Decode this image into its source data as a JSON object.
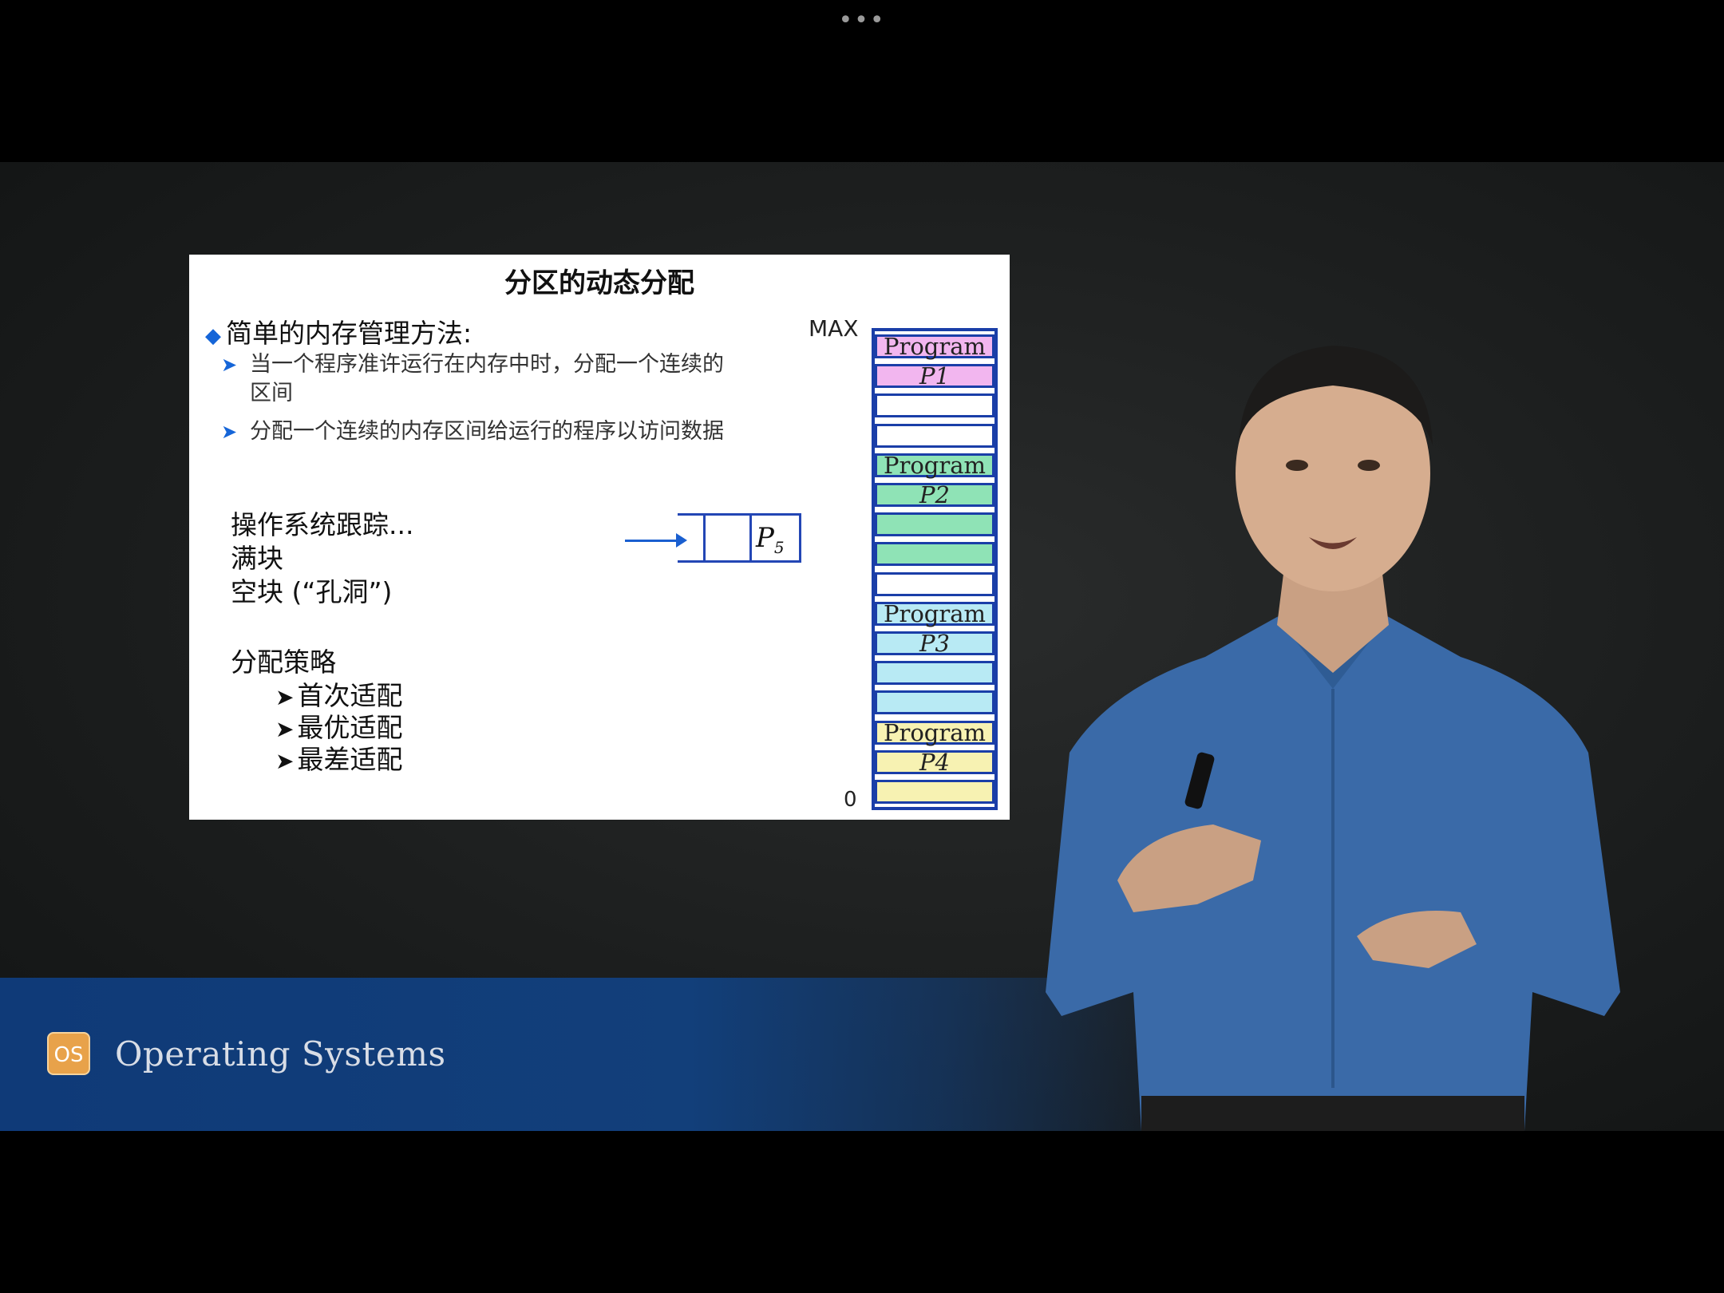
{
  "player": {
    "menu_label": "•••"
  },
  "slide": {
    "title": "分区的动态分配",
    "heading": "简单的内存管理方法:",
    "sub_items": [
      "当一个程序准许运行在内存中时，分配一个连续的区间",
      "分配一个连续的内存区间给运行的程序以访问数据"
    ],
    "tracking": "操作系统跟踪...",
    "full_block": "满块",
    "free_block": "空块 (“孔洞”)",
    "strategy_heading": "分配策略",
    "strategies": [
      "首次适配",
      "最优适配",
      "最差适配"
    ],
    "queue_label": "P",
    "queue_subscript": "5",
    "memory": {
      "max_label": "MAX",
      "zero_label": "0",
      "cells": [
        {
          "text": "Program",
          "color": "#f2b6ef"
        },
        {
          "text": "P1",
          "color": "#f2b6ef"
        },
        {
          "text": "",
          "color": "#ffffff"
        },
        {
          "text": "",
          "color": "#ffffff"
        },
        {
          "text": "Program",
          "color": "#8fe3b6"
        },
        {
          "text": "P2",
          "color": "#8fe3b6"
        },
        {
          "text": "",
          "color": "#8fe3b6"
        },
        {
          "text": "",
          "color": "#8fe3b6"
        },
        {
          "text": "",
          "color": "#ffffff"
        },
        {
          "text": "Program",
          "color": "#b8eaf4"
        },
        {
          "text": "P3",
          "color": "#b8eaf4"
        },
        {
          "text": "",
          "color": "#b8eaf4"
        },
        {
          "text": "",
          "color": "#b8eaf4"
        },
        {
          "text": "Program",
          "color": "#f7f2b2"
        },
        {
          "text": "P4",
          "color": "#f7f2b2"
        },
        {
          "text": "",
          "color": "#f7f2b2"
        }
      ]
    }
  },
  "banner": {
    "logo_text": "OS",
    "title": "Operating Systems"
  },
  "colors": {
    "accent": "#1565d8",
    "banner": "#123f7a",
    "memory_border": "#1a3ea8"
  }
}
